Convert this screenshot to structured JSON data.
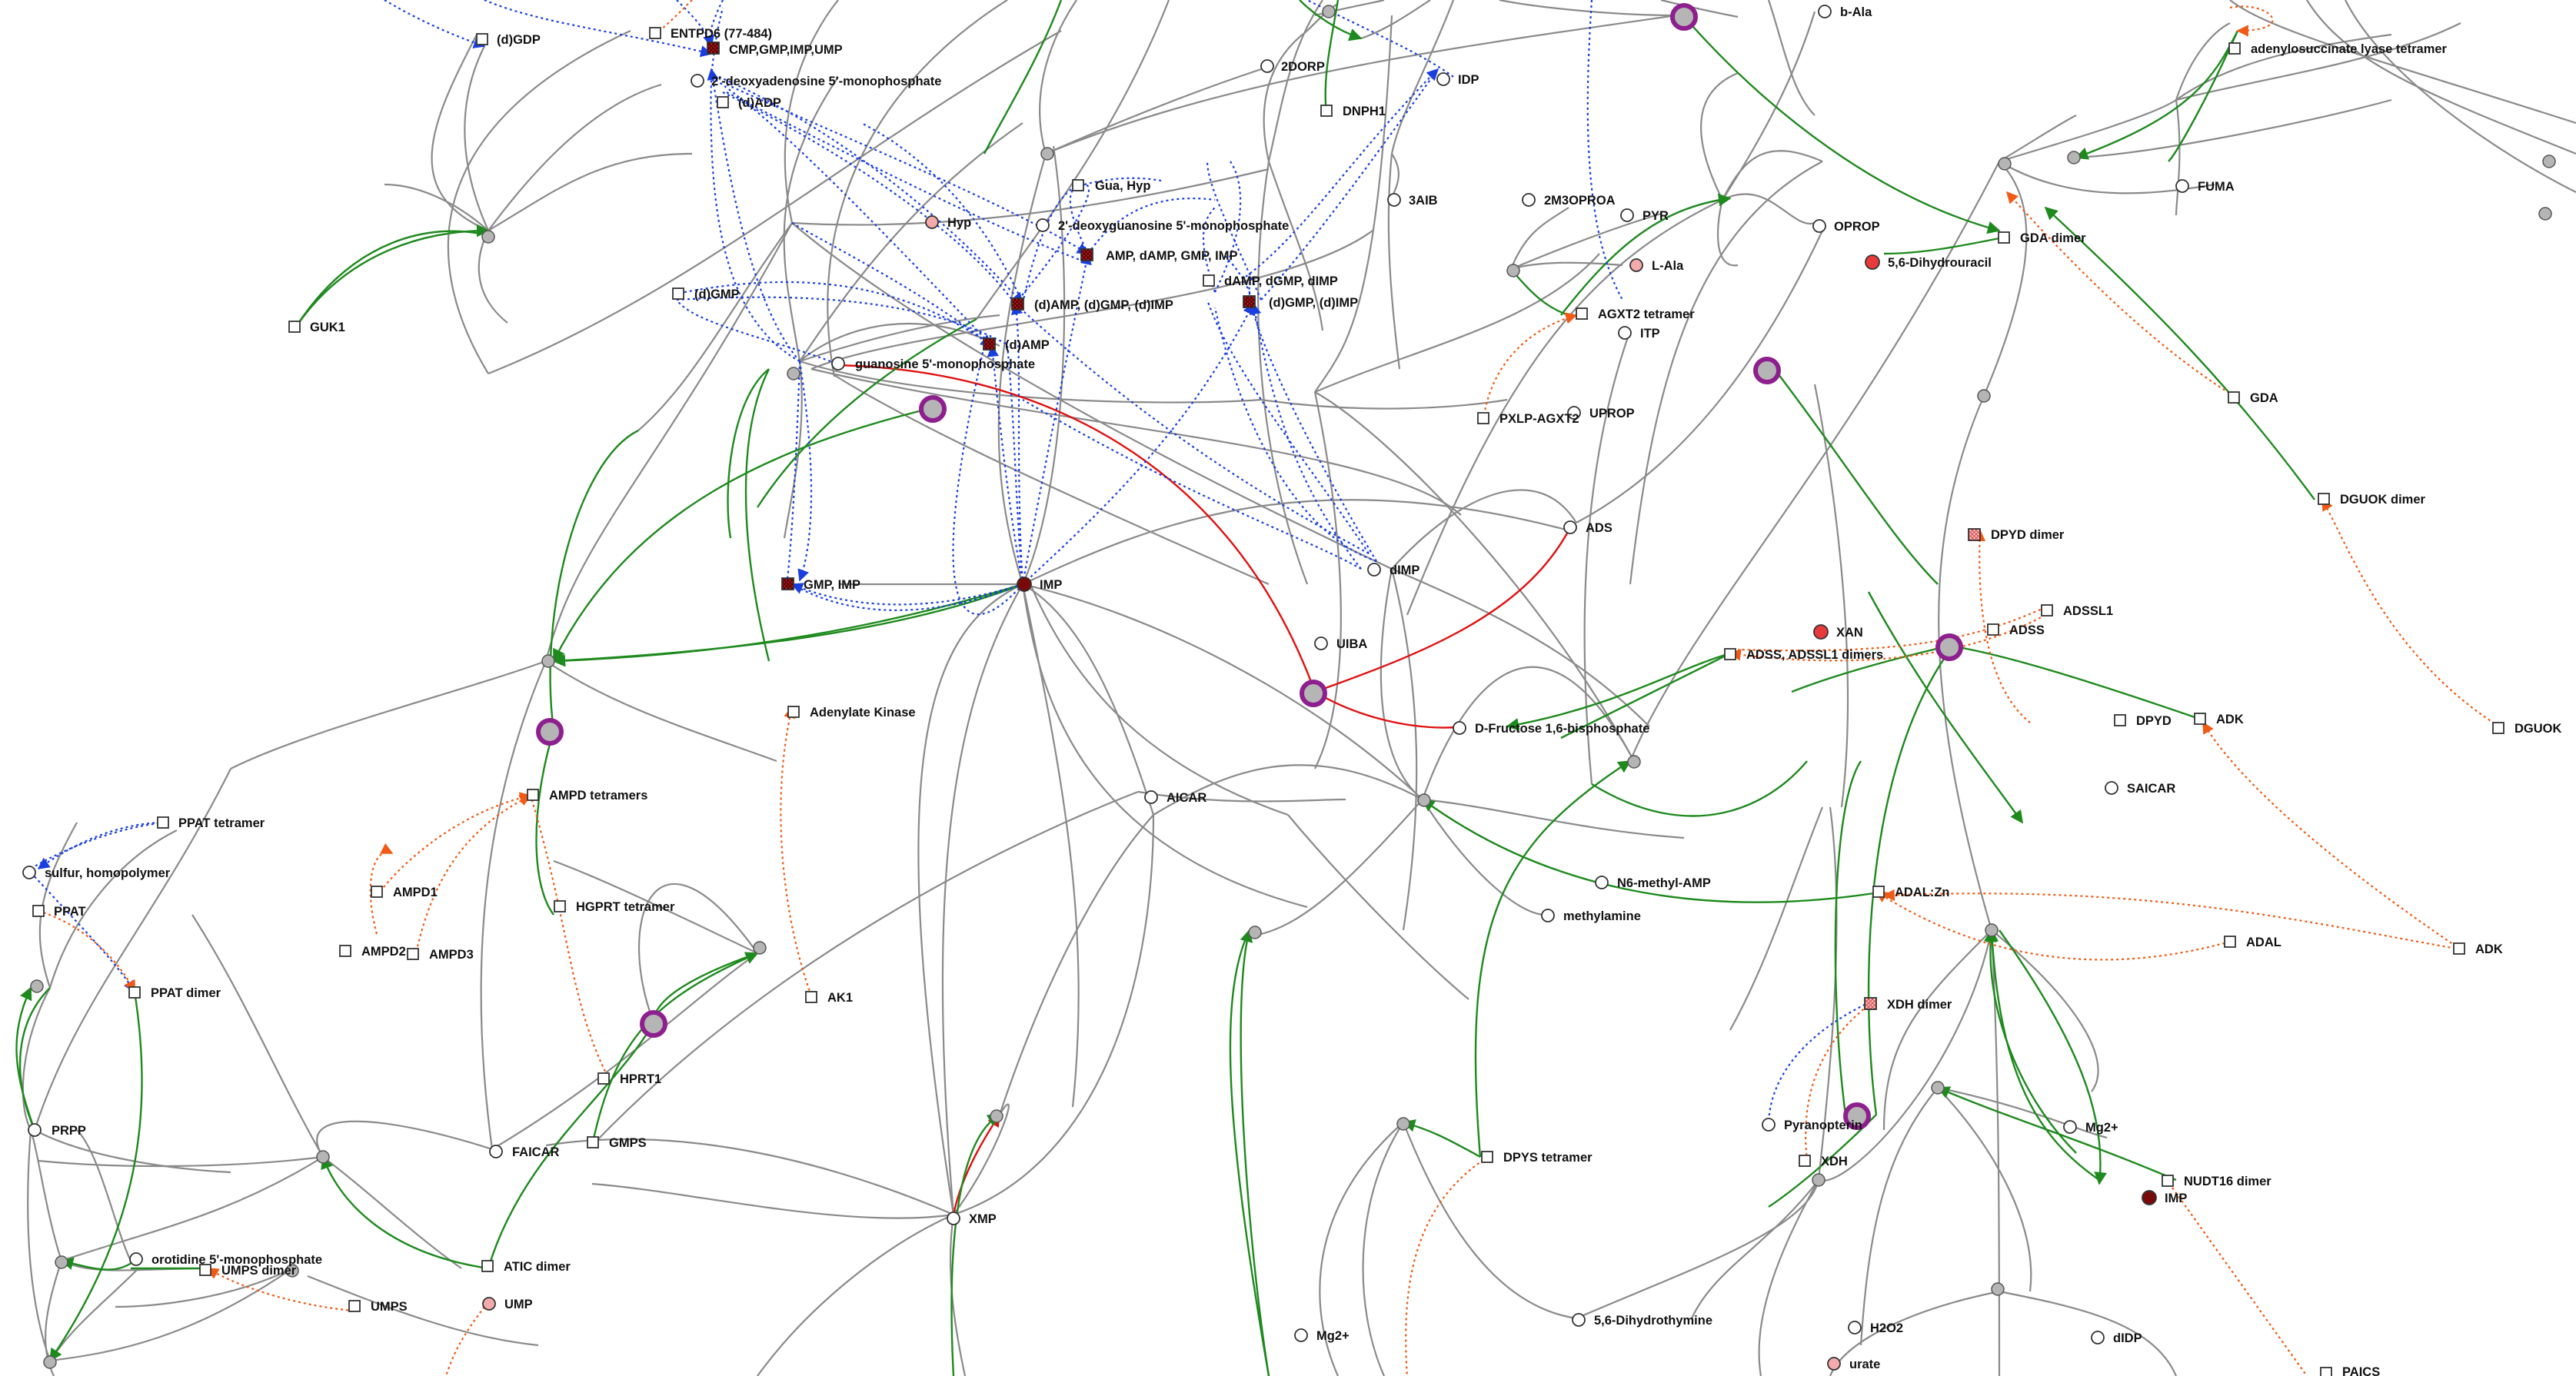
{
  "colors": {
    "background": "#ffffff",
    "edge_gray": "#8a8a8a",
    "edge_green": "#1e8a1e",
    "edge_red": "#e01010",
    "edge_blue_dotted": "#1a3fe0",
    "edge_orange_dotted": "#f05a14",
    "process_fill": "#b5b5b5",
    "hub_ring": "#8e1f8e",
    "highlight_light": "#f3aaaa",
    "highlight_mid": "#e83a3a",
    "highlight_dark": "#7a0a0a"
  },
  "nodes": [
    {
      "id": "dgdp",
      "label": "(d)GDP",
      "shape": "square"
    },
    {
      "id": "entpd6",
      "label": "ENTPD6 (77-484)",
      "shape": "square"
    },
    {
      "id": "cmp_gmp",
      "label": "CMP,GMP,IMP,UMP",
      "shape": "hatched"
    },
    {
      "id": "dampm",
      "label": "2'-deoxyadenosine 5'-monophosphate",
      "shape": "circle"
    },
    {
      "id": "dadp",
      "label": "(d)ADP",
      "shape": "square"
    },
    {
      "id": "dgmp",
      "label": "(d)GMP",
      "shape": "square"
    },
    {
      "id": "guk1",
      "label": "GUK1",
      "shape": "square"
    },
    {
      "id": "hyp",
      "label": "Hyp",
      "shape": "circle-light"
    },
    {
      "id": "gua_hyp",
      "label": "Gua, Hyp",
      "shape": "square"
    },
    {
      "id": "dgmp5",
      "label": "2'-deoxyguanosine 5'-monophosphate",
      "shape": "circle"
    },
    {
      "id": "amp_damp",
      "label": "AMP, dAMP, GMP, IMP",
      "shape": "hatched"
    },
    {
      "id": "damp_dgmp",
      "label": "dAMP, dGMP, dIMP",
      "shape": "square"
    },
    {
      "id": "d_amp_gmp",
      "label": "(d)AMP, (d)GMP, (d)IMP",
      "shape": "hatched"
    },
    {
      "id": "dgmp_dimp",
      "label": "(d)GMP, (d)IMP",
      "shape": "hatched"
    },
    {
      "id": "d_amp",
      "label": "(d)AMP",
      "shape": "hatched"
    },
    {
      "id": "guanosine",
      "label": "guanosine 5'-monophosphate",
      "shape": "circle"
    },
    {
      "id": "dorp",
      "label": "2DORP",
      "shape": "circle"
    },
    {
      "id": "dnph1",
      "label": "DNPH1",
      "shape": "square"
    },
    {
      "id": "idp",
      "label": "IDP",
      "shape": "circle"
    },
    {
      "id": "aib3",
      "label": "3AIB",
      "shape": "circle"
    },
    {
      "id": "oproa",
      "label": "2M3OPROA",
      "shape": "circle"
    },
    {
      "id": "pyr",
      "label": "PYR",
      "shape": "circle"
    },
    {
      "id": "oprop",
      "label": "OPROP",
      "shape": "circle"
    },
    {
      "id": "lala",
      "label": "L-Ala",
      "shape": "circle-light"
    },
    {
      "id": "agxt2",
      "label": "AGXT2 tetramer",
      "shape": "square"
    },
    {
      "id": "itp",
      "label": "ITP",
      "shape": "circle"
    },
    {
      "id": "pxlp",
      "label": "PXLP-AGXT2",
      "shape": "square"
    },
    {
      "id": "uprop",
      "label": "UPROP",
      "shape": "circle"
    },
    {
      "id": "bala",
      "label": "b-Ala",
      "shape": "circle"
    },
    {
      "id": "adsl",
      "label": "adenylosuccinate lyase tetramer",
      "shape": "square"
    },
    {
      "id": "fuma",
      "label": "FUMA",
      "shape": "circle"
    },
    {
      "id": "gda_dimer",
      "label": "GDA dimer",
      "shape": "square"
    },
    {
      "id": "dhu",
      "label": "5,6-Dihydrouracil",
      "shape": "circle-mid"
    },
    {
      "id": "gda",
      "label": "GDA",
      "shape": "square"
    },
    {
      "id": "dguok_dimer",
      "label": "DGUOK dimer",
      "shape": "square"
    },
    {
      "id": "dpyd_dimer",
      "label": "DPYD dimer",
      "shape": "hatched-light"
    },
    {
      "id": "adssl1",
      "label": "ADSSL1",
      "shape": "square"
    },
    {
      "id": "adss",
      "label": "ADSS",
      "shape": "square"
    },
    {
      "id": "xan",
      "label": "XAN",
      "shape": "circle-mid"
    },
    {
      "id": "adss_dimers",
      "label": "ADSS, ADSSL1 dimers",
      "shape": "square"
    },
    {
      "id": "dpyd",
      "label": "DPYD",
      "shape": "square"
    },
    {
      "id": "adk1",
      "label": "ADK",
      "shape": "square"
    },
    {
      "id": "dguok",
      "label": "DGUOK",
      "shape": "square"
    },
    {
      "id": "ads",
      "label": "ADS",
      "shape": "circle"
    },
    {
      "id": "dimp",
      "label": "dIMP",
      "shape": "circle"
    },
    {
      "id": "imp_main",
      "label": "IMP",
      "shape": "circle-dark"
    },
    {
      "id": "gmp_imp",
      "label": "GMP, IMP",
      "shape": "hatched"
    },
    {
      "id": "uiba",
      "label": "UIBA",
      "shape": "circle"
    },
    {
      "id": "dfbp",
      "label": "D-Fructose 1,6-bisphosphate",
      "shape": "circle"
    },
    {
      "id": "adenylate",
      "label": "Adenylate Kinase",
      "shape": "square"
    },
    {
      "id": "ampd_tet",
      "label": "AMPD tetramers",
      "shape": "square"
    },
    {
      "id": "ppat_tet",
      "label": "PPAT tetramer",
      "shape": "square"
    },
    {
      "id": "sulfur",
      "label": "sulfur, homopolymer",
      "shape": "circle"
    },
    {
      "id": "ppat",
      "label": "PPAT",
      "shape": "square"
    },
    {
      "id": "ampd1",
      "label": "AMPD1",
      "shape": "square"
    },
    {
      "id": "ampd2",
      "label": "AMPD2",
      "shape": "square"
    },
    {
      "id": "ampd3",
      "label": "AMPD3",
      "shape": "square"
    },
    {
      "id": "hgprt",
      "label": "HGPRT tetramer",
      "shape": "square"
    },
    {
      "id": "ppat_dimer",
      "label": "PPAT dimer",
      "shape": "square"
    },
    {
      "id": "ak1",
      "label": "AK1",
      "shape": "square"
    },
    {
      "id": "aicar",
      "label": "AICAR",
      "shape": "circle"
    },
    {
      "id": "saicar",
      "label": "SAICAR",
      "shape": "circle"
    },
    {
      "id": "n6",
      "label": "N6-methyl-AMP",
      "shape": "circle"
    },
    {
      "id": "methylamine",
      "label": "methylamine",
      "shape": "circle"
    },
    {
      "id": "adal_zn",
      "label": "ADAL:Zn",
      "shape": "square"
    },
    {
      "id": "adal",
      "label": "ADAL",
      "shape": "square"
    },
    {
      "id": "adk2",
      "label": "ADK",
      "shape": "square"
    },
    {
      "id": "xdh_dimer",
      "label": "XDH dimer",
      "shape": "hatched-light"
    },
    {
      "id": "hprt1",
      "label": "HPRT1",
      "shape": "square"
    },
    {
      "id": "prpp",
      "label": "PRPP",
      "shape": "circle"
    },
    {
      "id": "faicar",
      "label": "FAICAR",
      "shape": "circle"
    },
    {
      "id": "gmps",
      "label": "GMPS",
      "shape": "square"
    },
    {
      "id": "xmp",
      "label": "XMP",
      "shape": "circle"
    },
    {
      "id": "dpys",
      "label": "DPYS tetramer",
      "shape": "square"
    },
    {
      "id": "pyranopterin",
      "label": "Pyranopterin",
      "shape": "circle"
    },
    {
      "id": "xdh",
      "label": "XDH",
      "shape": "square"
    },
    {
      "id": "mg2_r",
      "label": "Mg2+",
      "shape": "circle"
    },
    {
      "id": "nudt16",
      "label": "NUDT16 dimer",
      "shape": "square"
    },
    {
      "id": "imp_r",
      "label": "IMP",
      "shape": "circle-dark"
    },
    {
      "id": "omp",
      "label": "orotidine 5'-monophosphate",
      "shape": "circle"
    },
    {
      "id": "umps_dimer",
      "label": "UMPS dimer",
      "shape": "square"
    },
    {
      "id": "atic",
      "label": "ATIC dimer",
      "shape": "square"
    },
    {
      "id": "umps",
      "label": "UMPS",
      "shape": "square"
    },
    {
      "id": "ump",
      "label": "UMP",
      "shape": "circle-light"
    },
    {
      "id": "dhthy",
      "label": "5,6-Dihydrothymine",
      "shape": "circle"
    },
    {
      "id": "mg2_b",
      "label": "Mg2+",
      "shape": "circle"
    },
    {
      "id": "h2o2",
      "label": "H2O2",
      "shape": "circle"
    },
    {
      "id": "urate",
      "label": "urate",
      "shape": "circle-light"
    },
    {
      "id": "didp",
      "label": "dIDP",
      "shape": "circle"
    },
    {
      "id": "paics",
      "label": "PAICS",
      "shape": "square"
    }
  ]
}
